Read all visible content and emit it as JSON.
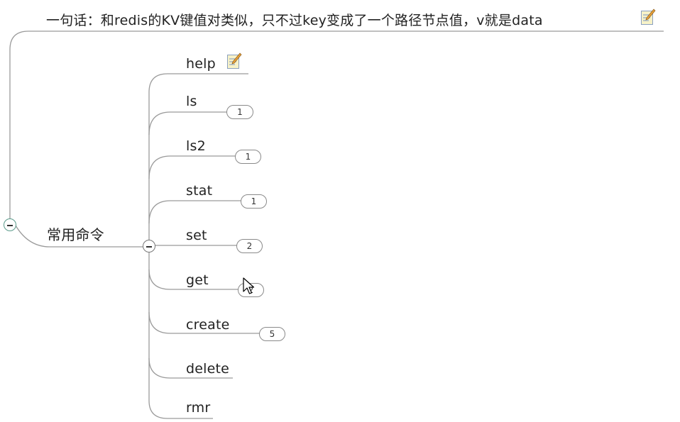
{
  "summary": {
    "text": "一句话：和redis的KV键值对类似，只不过key变成了一个路径节点值，v就是data"
  },
  "root": {
    "label": "常用命令"
  },
  "children": [
    {
      "key": "help",
      "label": "help",
      "badge": null,
      "note": true
    },
    {
      "key": "ls",
      "label": "ls",
      "badge": "1"
    },
    {
      "key": "ls2",
      "label": "ls2",
      "badge": "1"
    },
    {
      "key": "stat",
      "label": "stat",
      "badge": "1"
    },
    {
      "key": "set",
      "label": "set",
      "badge": "2"
    },
    {
      "key": "get",
      "label": "get",
      "badge": "2"
    },
    {
      "key": "create",
      "label": "create",
      "badge": "5"
    },
    {
      "key": "delete",
      "label": "delete",
      "badge": null
    },
    {
      "key": "rmr",
      "label": "rmr",
      "badge": null
    }
  ],
  "icons": {
    "note": "note-pencil-icon",
    "collapse": "minus-collapse-icon",
    "cursor": "mouse-pointer-icon"
  },
  "colors": {
    "branch_line": "#9a9a9a",
    "collapse_outer": "#5a9a8a",
    "collapse_inner": "#777777"
  }
}
